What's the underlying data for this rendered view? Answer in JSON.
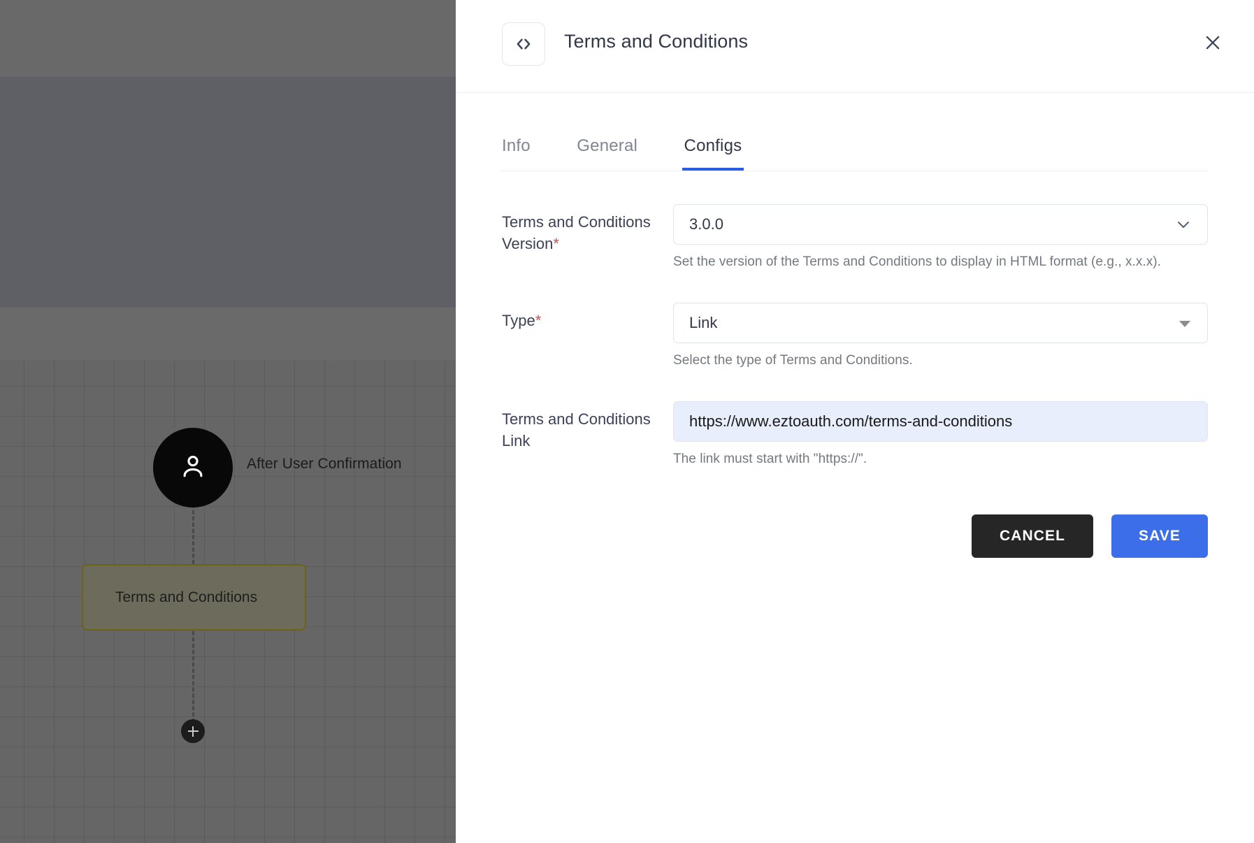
{
  "canvas": {
    "user_node_icon": "user-icon",
    "node_caption": "After User Confirmation",
    "flow_node_label": "Terms and Conditions",
    "add_node_icon": "plus-icon"
  },
  "panel": {
    "header": {
      "icon": "code-brackets-icon",
      "title": "Terms and Conditions",
      "close_icon": "close-icon"
    },
    "tabs": [
      {
        "label": "Info",
        "active": false
      },
      {
        "label": "General",
        "active": false
      },
      {
        "label": "Configs",
        "active": true
      }
    ],
    "fields": {
      "version": {
        "label": "Terms and Conditions Version",
        "required": true,
        "value": "3.0.0",
        "helper": "Set the version of the Terms and Conditions to display in HTML format (e.g., x.x.x).",
        "icon": "chevron-down-icon"
      },
      "type": {
        "label": "Type",
        "required": true,
        "value": "Link",
        "helper": "Select the type of Terms and Conditions.",
        "icon": "caret-down-icon"
      },
      "link": {
        "label": "Terms and Conditions Link",
        "required": false,
        "value": "https://www.eztoauth.com/terms-and-conditions",
        "helper": "The link must start with \"https://\"."
      }
    },
    "actions": {
      "cancel_label": "CANCEL",
      "save_label": "SAVE"
    }
  },
  "colors": {
    "accent": "#2b5ce6",
    "save_button": "#3b6ee8",
    "cancel_button": "#262626",
    "required_marker": "#cf5050",
    "autofill_background": "#e8eefb"
  }
}
